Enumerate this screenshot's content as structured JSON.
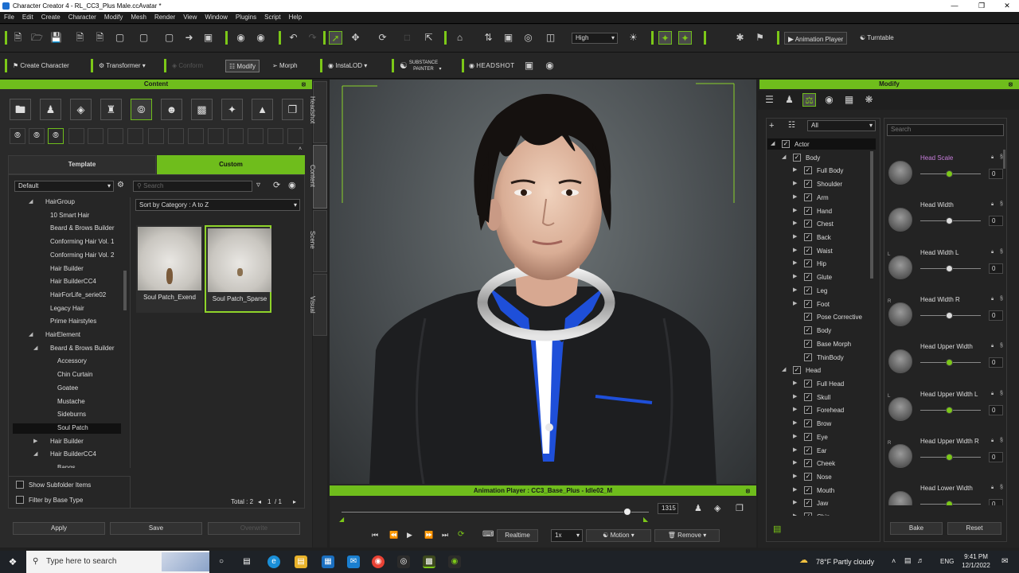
{
  "window": {
    "title": "Character Creator 4 - RL_CC3_Plus Male.ccAvatar *"
  },
  "menu": [
    "File",
    "Edit",
    "Create",
    "Character",
    "Modify",
    "Mesh",
    "Render",
    "View",
    "Window",
    "Plugins",
    "Script",
    "Help"
  ],
  "toolbar": {
    "quality": "High",
    "animation_player": "Animation Player",
    "turntable": "Turntable"
  },
  "toolbar2": {
    "create_character": "Create Character",
    "transformer": "Transformer",
    "conform": "Conform",
    "modify": "Modify",
    "morph": "Morph",
    "instalod": "InstaLOD",
    "substance": "SUBSTANCE PAINTER",
    "headshot": "HEADSHOT"
  },
  "content": {
    "header": "Content",
    "tabs": [
      "Template",
      "Custom"
    ],
    "active_tab": "Custom",
    "folder_select": "Default",
    "search_placeholder": "Search",
    "sort": "Sort by Category : A to Z",
    "tree": [
      {
        "label": "HairGroup",
        "level": 2,
        "arrow": "down"
      },
      {
        "label": "10 Smart Hair",
        "level": 3
      },
      {
        "label": "Beard & Brows Builder",
        "level": 3
      },
      {
        "label": "Conforming Hair Vol. 1",
        "level": 3
      },
      {
        "label": "Conforming Hair Vol. 2",
        "level": 3
      },
      {
        "label": "Hair Builder",
        "level": 3
      },
      {
        "label": "Hair BuilderCC4",
        "level": 3
      },
      {
        "label": "HairForLife_serie02",
        "level": 3
      },
      {
        "label": "Legacy Hair",
        "level": 3
      },
      {
        "label": "Prime Hairstyles",
        "level": 3
      },
      {
        "label": "HairElement",
        "level": 2,
        "arrow": "down"
      },
      {
        "label": "Beard & Brows Builder",
        "level": 3,
        "arrow": "down"
      },
      {
        "label": "Accessory",
        "level": 4
      },
      {
        "label": "Chin Curtain",
        "level": 4
      },
      {
        "label": "Goatee",
        "level": 4
      },
      {
        "label": "Mustache",
        "level": 4
      },
      {
        "label": "Sideburns",
        "level": 4
      },
      {
        "label": "Soul Patch",
        "level": 4,
        "selected": true
      },
      {
        "label": "Hair Builder",
        "level": 3,
        "arrow": "right"
      },
      {
        "label": "Hair BuilderCC4",
        "level": 3,
        "arrow": "down"
      },
      {
        "label": "Bangs",
        "level": 4
      }
    ],
    "items": [
      {
        "label": "Soul Patch_Exend",
        "selected": false
      },
      {
        "label": "Soul Patch_Sparse",
        "selected": true
      }
    ],
    "show_subfolder": "Show Subfolder Items",
    "filter_base": "Filter by Base Type",
    "total": "Total : 2",
    "page": "1",
    "page_of": "/  1",
    "apply": "Apply",
    "save": "Save",
    "overwrite": "Overwrite"
  },
  "side_tabs": [
    "Headshot",
    "Content",
    "Scene",
    "Visual"
  ],
  "animation": {
    "header": "Animation Player : CC3_Base_Plus - Idle02_M",
    "frame": "1315",
    "realtime": "Realtime",
    "speed": "1x",
    "motion": "Motion",
    "remove": "Remove",
    "progress": 0.93
  },
  "modify": {
    "header": "Modify",
    "filter": "All",
    "search_placeholder": "Search",
    "tree": [
      {
        "label": "Actor",
        "level": 0,
        "arrow": "down"
      },
      {
        "label": "Body",
        "level": 1,
        "arrow": "down"
      },
      {
        "label": "Full Body",
        "level": 2,
        "arrow": "right"
      },
      {
        "label": "Shoulder",
        "level": 2,
        "arrow": "right"
      },
      {
        "label": "Arm",
        "level": 2,
        "arrow": "right"
      },
      {
        "label": "Hand",
        "level": 2,
        "arrow": "right"
      },
      {
        "label": "Chest",
        "level": 2,
        "arrow": "right"
      },
      {
        "label": "Back",
        "level": 2,
        "arrow": "right"
      },
      {
        "label": "Waist",
        "level": 2,
        "arrow": "right"
      },
      {
        "label": "Hip",
        "level": 2,
        "arrow": "right"
      },
      {
        "label": "Glute",
        "level": 2,
        "arrow": "right"
      },
      {
        "label": "Leg",
        "level": 2,
        "arrow": "right"
      },
      {
        "label": "Foot",
        "level": 2,
        "arrow": "right"
      },
      {
        "label": "Pose Corrective",
        "level": 2
      },
      {
        "label": "Body",
        "level": 2
      },
      {
        "label": "Base Morph",
        "level": 2
      },
      {
        "label": "ThinBody",
        "level": 2
      },
      {
        "label": "Head",
        "level": 1,
        "arrow": "down"
      },
      {
        "label": "Full Head",
        "level": 2,
        "arrow": "right"
      },
      {
        "label": "Skull",
        "level": 2,
        "arrow": "right"
      },
      {
        "label": "Forehead",
        "level": 2,
        "arrow": "right"
      },
      {
        "label": "Brow",
        "level": 2,
        "arrow": "right"
      },
      {
        "label": "Eye",
        "level": 2,
        "arrow": "right"
      },
      {
        "label": "Ear",
        "level": 2,
        "arrow": "right"
      },
      {
        "label": "Cheek",
        "level": 2,
        "arrow": "right"
      },
      {
        "label": "Nose",
        "level": 2,
        "arrow": "right"
      },
      {
        "label": "Mouth",
        "level": 2,
        "arrow": "right"
      },
      {
        "label": "Jaw",
        "level": 2,
        "arrow": "right"
      },
      {
        "label": "Chin",
        "level": 2,
        "arrow": "right"
      }
    ],
    "sliders": [
      {
        "label": "Head Scale",
        "value": "0",
        "side": "",
        "green": true,
        "highlight": true
      },
      {
        "label": "Head Width",
        "value": "0",
        "side": "",
        "green": false
      },
      {
        "label": "Head Width L",
        "value": "0",
        "side": "L",
        "green": false
      },
      {
        "label": "Head Width R",
        "value": "0",
        "side": "R",
        "green": false
      },
      {
        "label": "Head Upper Width",
        "value": "0",
        "side": "",
        "green": true
      },
      {
        "label": "Head Upper Width L",
        "value": "0",
        "side": "L",
        "green": true
      },
      {
        "label": "Head Upper Width R",
        "value": "0",
        "side": "R",
        "green": true
      },
      {
        "label": "Head Lower Width",
        "value": "0",
        "side": "",
        "green": true
      }
    ],
    "bake": "Bake",
    "reset": "Reset"
  },
  "taskbar": {
    "search_placeholder": "Type here to search",
    "weather": "78°F  Partly cloudy",
    "lang": "ENG",
    "time": "9:41 PM",
    "date": "12/1/2022"
  }
}
